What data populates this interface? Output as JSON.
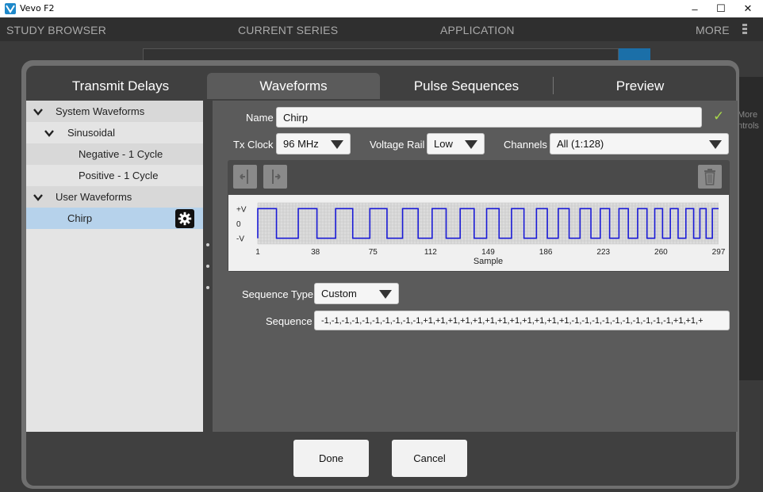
{
  "window": {
    "title": "Vevo F2",
    "minimize_glyph": "–",
    "maximize_glyph": "☐",
    "close_glyph": "✕"
  },
  "nav": {
    "study_browser": "STUDY BROWSER",
    "current_series": "CURRENT SERIES",
    "application": "APPLICATION",
    "more": "MORE",
    "kebab_icon": "kebab-menu-icon"
  },
  "background": {
    "more_controls_line1": "More",
    "more_controls_line2": "ntrols"
  },
  "tabs": [
    {
      "label": "Transmit Delays"
    },
    {
      "label": "Waveforms",
      "active": true
    },
    {
      "label": "Pulse Sequences"
    },
    {
      "label": "Preview"
    }
  ],
  "tree": {
    "system_waveforms": "System Waveforms",
    "sinusoidal": "Sinusoidal",
    "negative": "Negative - 1 Cycle",
    "positive": "Positive - 1 Cycle",
    "user_waveforms": "User Waveforms",
    "chirp": "Chirp"
  },
  "form": {
    "name_label": "Name",
    "name_value": "Chirp",
    "check_glyph": "✓",
    "tx_clock_label": "Tx Clock",
    "tx_clock_value": "96 MHz",
    "voltage_rail_label": "Voltage Rail",
    "voltage_rail_value": "Low",
    "channels_label": "Channels",
    "channels_value": "All (1:128)",
    "sequence_type_label": "Sequence Type",
    "sequence_type_value": "Custom",
    "sequence_label": "Sequence",
    "sequence_value": "-1,-1,-1,-1,-1,-1,-1,-1,-1,-1,+1,+1,+1,+1,+1,+1,+1,+1,+1,+1,+1,+1,-1,-1,-1,-1,-1,-1,-1,-1,-1,-1,+1,+1,+"
  },
  "chart_data": {
    "type": "line",
    "xlabel": "Sample",
    "y_tick_labels": [
      "+V",
      "0",
      "-V"
    ],
    "x_tick_labels": [
      "1",
      "38",
      "75",
      "112",
      "149",
      "186",
      "223",
      "260",
      "297"
    ],
    "xlim": [
      1,
      297
    ],
    "ylim": [
      -1,
      1
    ],
    "line_color": "#1a1ad6",
    "grid": true,
    "series": [
      {
        "values_description_free": true,
        "transitions": [
          1,
          13,
          27,
          39,
          51,
          62,
          73,
          84,
          94,
          104,
          113,
          122,
          131,
          140,
          148,
          156,
          164,
          172,
          180,
          187,
          194,
          201,
          208,
          215,
          221,
          227,
          233,
          239,
          245,
          251,
          256,
          261,
          266,
          271,
          276,
          281,
          285,
          289,
          293,
          297
        ],
        "start_level": -1
      }
    ]
  },
  "buttons": {
    "done": "Done",
    "cancel": "Cancel"
  }
}
